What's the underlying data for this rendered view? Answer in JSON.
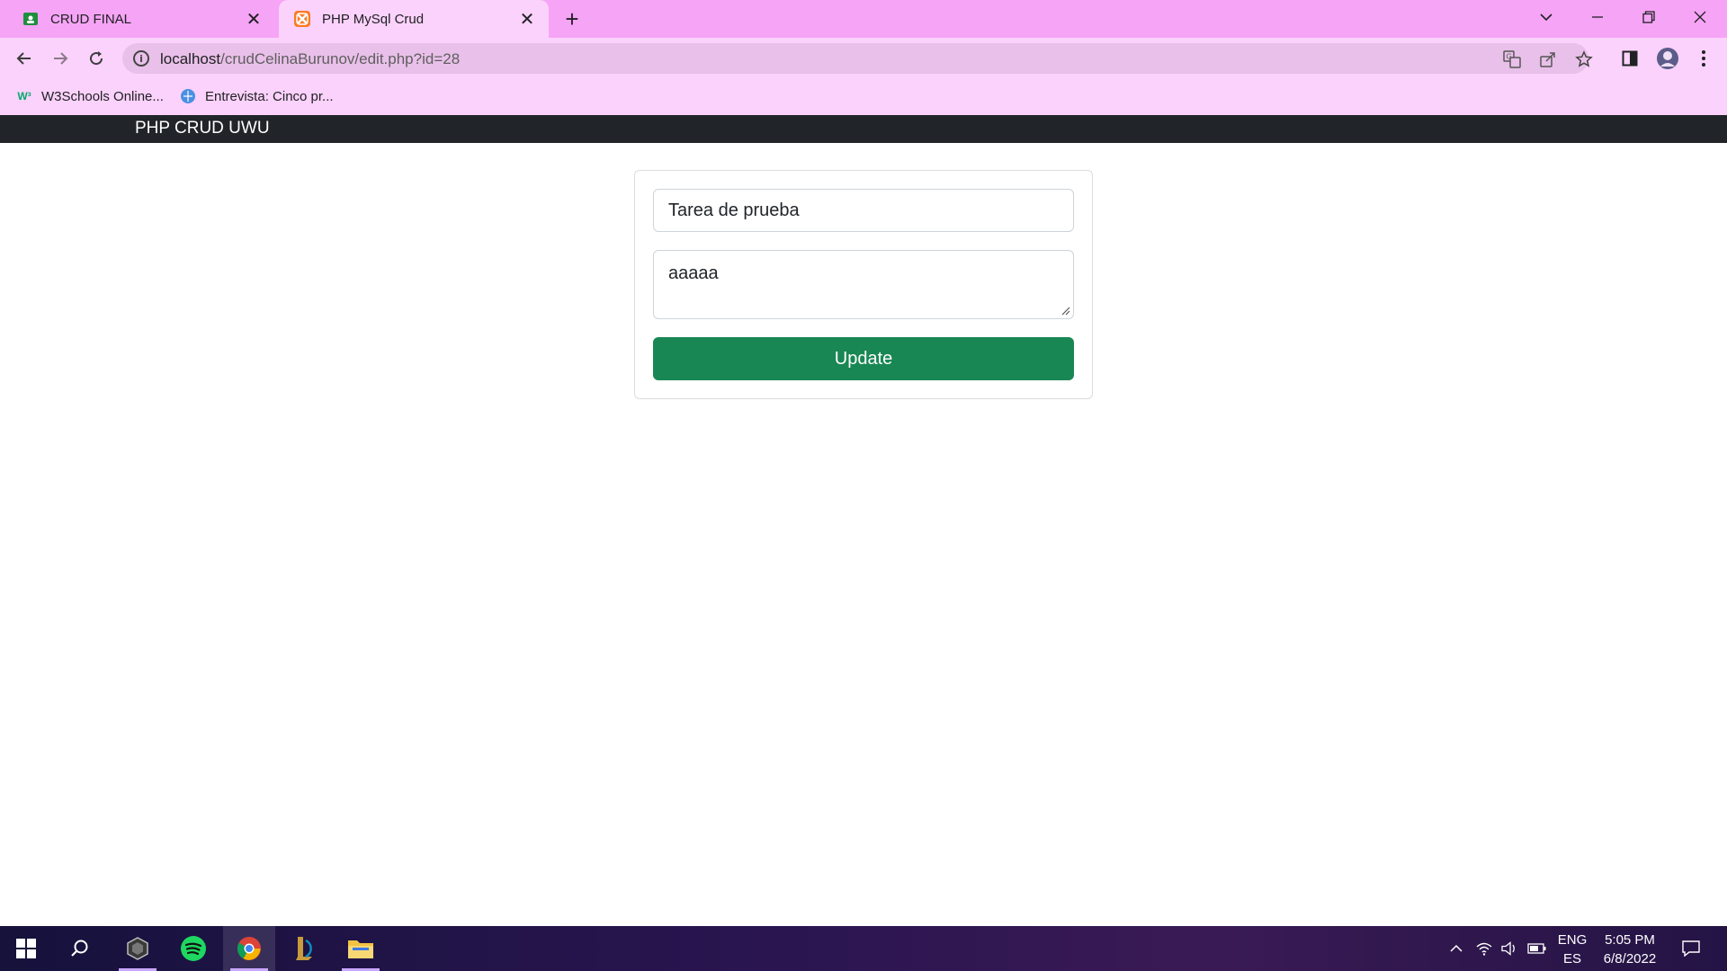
{
  "browser": {
    "tabs": [
      {
        "title": "CRUD FINAL",
        "icon": "google-classroom-icon",
        "active": false
      },
      {
        "title": "PHP MySql Crud",
        "icon": "xampp-icon",
        "active": true
      }
    ],
    "url_host": "localhost",
    "url_path": "/crudCelinaBurunov/edit.php?id=28",
    "bookmarks": [
      {
        "label": "W3Schools Online...",
        "icon": "w3schools-icon"
      },
      {
        "label": "Entrevista: Cinco pr...",
        "icon": "globe-icon"
      }
    ],
    "chrome_color": "#f6a4f6",
    "toolbar_color": "#fbd2fb"
  },
  "navbar": {
    "brand": "PHP CRUD UWU",
    "background": "#212529"
  },
  "form": {
    "title_value": "Tarea de prueba",
    "description_value": "aaaaa",
    "submit_label": "Update",
    "submit_color": "#198754"
  },
  "taskbar": {
    "apps": [
      "start-icon",
      "search-icon",
      "app-icon",
      "spotify-icon",
      "chrome-icon",
      "league-of-legends-icon",
      "file-explorer-icon"
    ],
    "language_top": "ENG",
    "language_bottom": "ES",
    "time": "5:05 PM",
    "date": "6/8/2022"
  }
}
